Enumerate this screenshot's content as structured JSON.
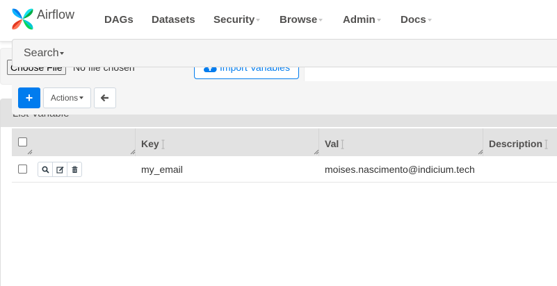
{
  "navbar": {
    "brand": "Airflow",
    "items": [
      {
        "label": "DAGs",
        "has_dropdown": false
      },
      {
        "label": "Datasets",
        "has_dropdown": false
      },
      {
        "label": "Security",
        "has_dropdown": true
      },
      {
        "label": "Browse",
        "has_dropdown": true
      },
      {
        "label": "Admin",
        "has_dropdown": true
      },
      {
        "label": "Docs",
        "has_dropdown": true
      }
    ]
  },
  "import": {
    "choose_file_label": "Choose File",
    "file_status": "No file chosen",
    "import_button_label": "Import Variables",
    "import_icon": "cloud-upload-icon"
  },
  "panel": {
    "title": "List Variable",
    "search_label": "Search"
  },
  "toolbar": {
    "add_label": "+",
    "actions_label": "Actions",
    "back_icon": "arrow-left-icon"
  },
  "table": {
    "columns": [
      "Key",
      "Val",
      "Description"
    ],
    "rows": [
      {
        "key": "my_email",
        "val": "moises.nascimento@indicium.tech",
        "description": ""
      }
    ],
    "row_actions": [
      "search-icon",
      "edit-icon",
      "trash-icon"
    ]
  },
  "colors": {
    "accent": "#017cee",
    "header_bg": "#e2e2e2",
    "panel_bg": "#f5f5f5",
    "text": "#51504f"
  }
}
